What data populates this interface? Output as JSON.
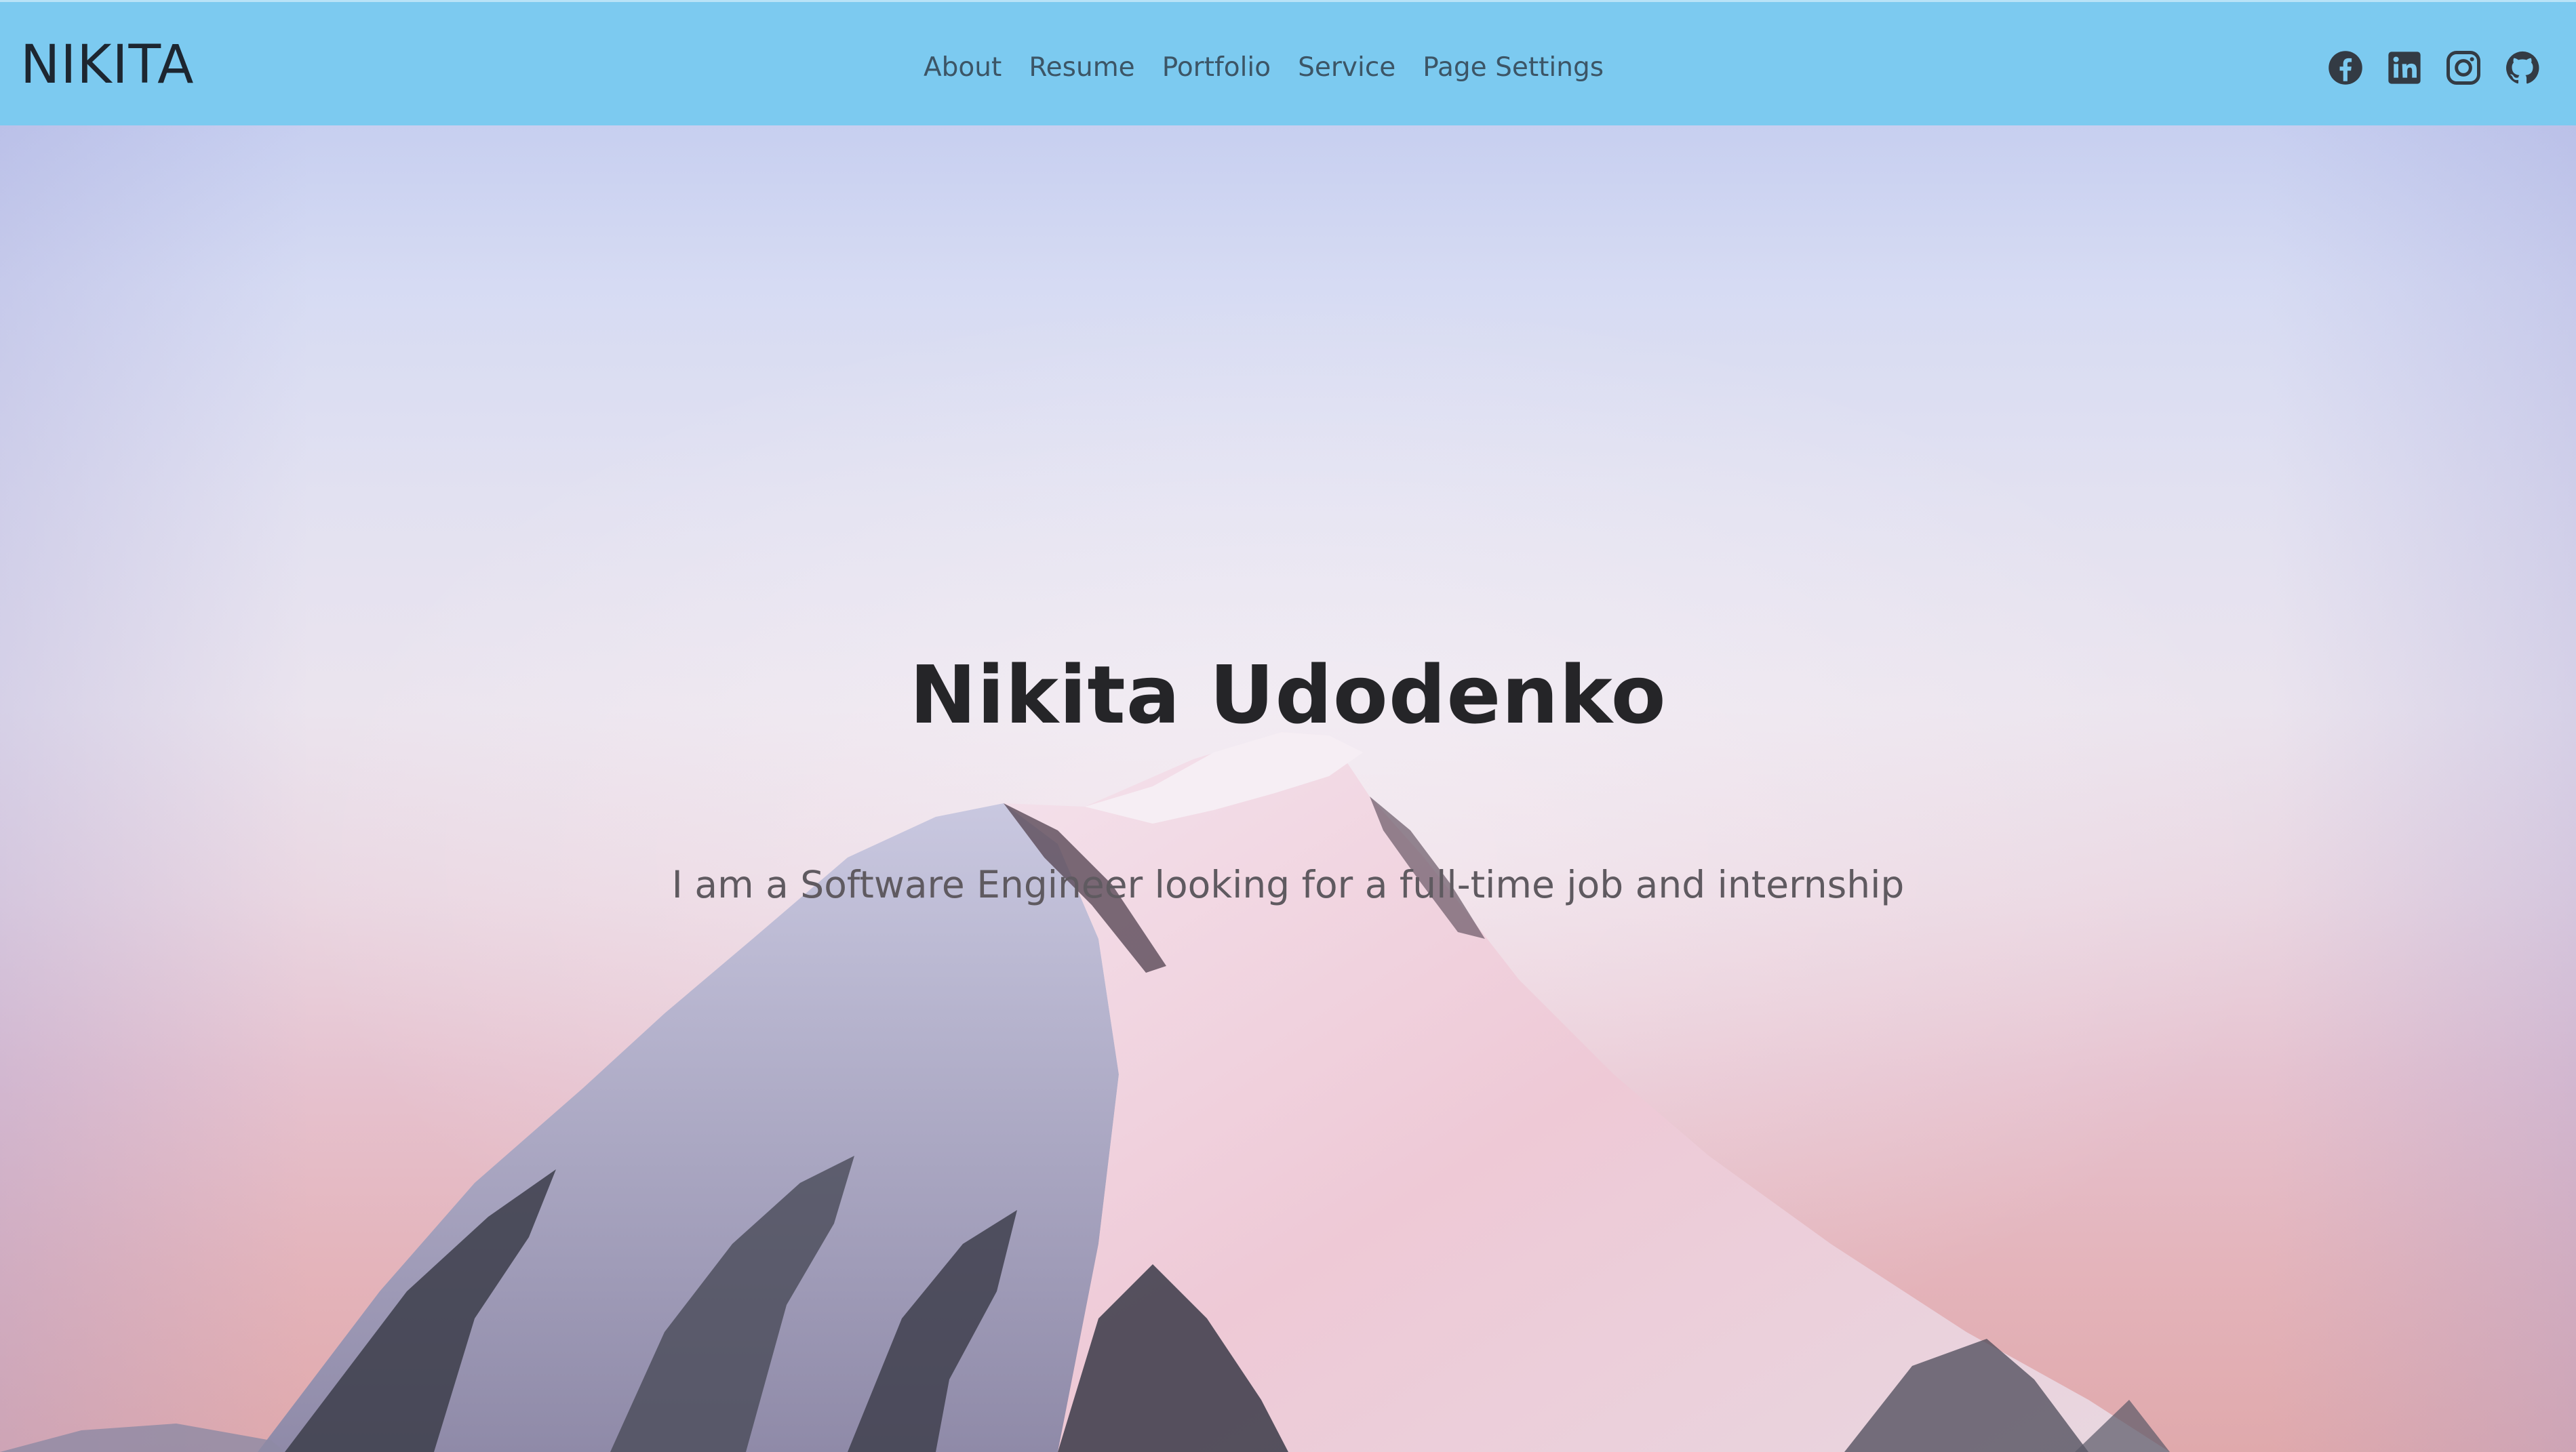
{
  "brand": {
    "name": "NIKITA"
  },
  "nav": {
    "items": [
      {
        "label": "About"
      },
      {
        "label": "Resume"
      },
      {
        "label": "Portfolio"
      },
      {
        "label": "Service"
      },
      {
        "label": "Page Settings"
      }
    ]
  },
  "social": {
    "icons": [
      "facebook-icon",
      "linkedin-icon",
      "instagram-icon",
      "github-icon"
    ]
  },
  "hero": {
    "title": "Nikita Udodenko",
    "subtitle": "I am a Software Engineer looking for a full-time job and internship",
    "background": "mountain-peak-photo"
  },
  "colors": {
    "header_bg": "#7ccaf0",
    "brand_text": "#1d2630",
    "nav_text": "#3c5566",
    "title_text": "#252528",
    "subtitle_text": "#5f5a60"
  }
}
